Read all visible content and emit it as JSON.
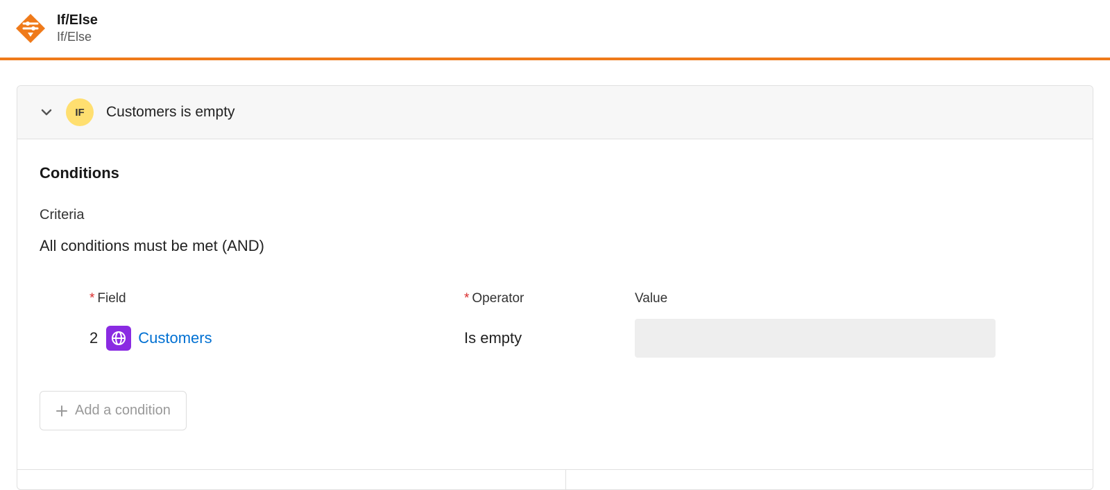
{
  "header": {
    "title": "If/Else",
    "subtitle": "If/Else"
  },
  "panel": {
    "badge": "IF",
    "title": "Customers is empty"
  },
  "conditions": {
    "heading": "Conditions",
    "criteria_label": "Criteria",
    "criteria_value": "All conditions must be met (AND)",
    "labels": {
      "field": "Field",
      "operator": "Operator",
      "value": "Value"
    },
    "row": {
      "step": "2",
      "field": "Customers",
      "operator": "Is empty",
      "value": ""
    },
    "add_button": "Add a condition"
  }
}
